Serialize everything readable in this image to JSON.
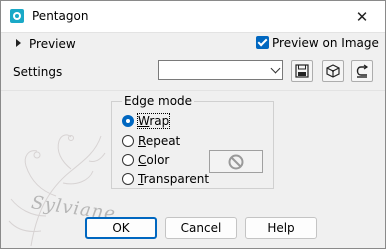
{
  "window": {
    "title": "Pentagon",
    "close_glyph": "✕"
  },
  "toolbar": {
    "preview_label": "Preview",
    "preview_on_image_label": "Preview on Image",
    "preview_on_image_checked": true,
    "settings_label": "Settings",
    "settings_value": "",
    "buttons": [
      "save-preset-icon",
      "3d-cube-icon",
      "reset-icon"
    ]
  },
  "edge_mode": {
    "group_label": "Edge mode",
    "options": [
      {
        "label": "Wrap",
        "mnemonic": "W",
        "rest": "rap",
        "selected": true
      },
      {
        "label": "Repeat",
        "mnemonic": "R",
        "rest": "epeat",
        "selected": false
      },
      {
        "label": "Color",
        "mnemonic": "C",
        "rest": "olor",
        "selected": false
      },
      {
        "label": "Transparent",
        "mnemonic": "T",
        "rest": "ransparent",
        "selected": false
      }
    ],
    "color_swatch_state": "disabled"
  },
  "footer": {
    "ok_label": "OK",
    "cancel_label": "Cancel",
    "help_label": "Help"
  },
  "watermark": {
    "text": "Sylviane"
  },
  "colors": {
    "accent": "#0067c0",
    "app_icon": "#1aa9c7",
    "background": "#f0f0f0"
  }
}
